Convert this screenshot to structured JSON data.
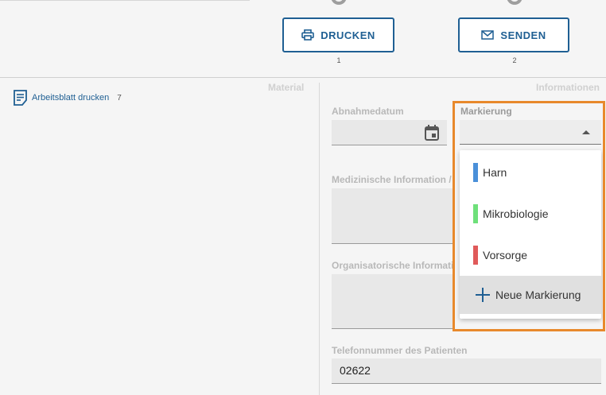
{
  "toolbar": {
    "print_button": {
      "label": "DRUCKEN",
      "step": "1",
      "icon": "printer-icon"
    },
    "send_button": {
      "label": "SENDEN",
      "step": "2",
      "icon": "envelope-icon"
    }
  },
  "sections": {
    "material": "Material",
    "information": "Informationen"
  },
  "worksheet": {
    "label": "Arbeitsblatt drucken",
    "count": "7",
    "icon": "document-icon"
  },
  "form": {
    "collection_date": {
      "label": "Abnahmedatum",
      "value": "",
      "icon": "calendar-icon"
    },
    "medical_info": {
      "label": "Medizinische Information / Di",
      "value": ""
    },
    "organizational_info": {
      "label": "Organisatorische Information",
      "value": ""
    },
    "patient_phone": {
      "label": "Telefonnummer des Patienten",
      "value": "02622"
    }
  },
  "marking": {
    "label": "Markierung",
    "selected": "",
    "options": [
      {
        "label": "Harn",
        "color": "#4a90d9"
      },
      {
        "label": "Mikrobiologie",
        "color": "#6ee07a"
      },
      {
        "label": "Vorsorge",
        "color": "#e05a5a"
      }
    ],
    "new_label": "Neue Markierung"
  },
  "colors": {
    "accent": "#1f5f93",
    "highlight_border": "#e8892c"
  }
}
